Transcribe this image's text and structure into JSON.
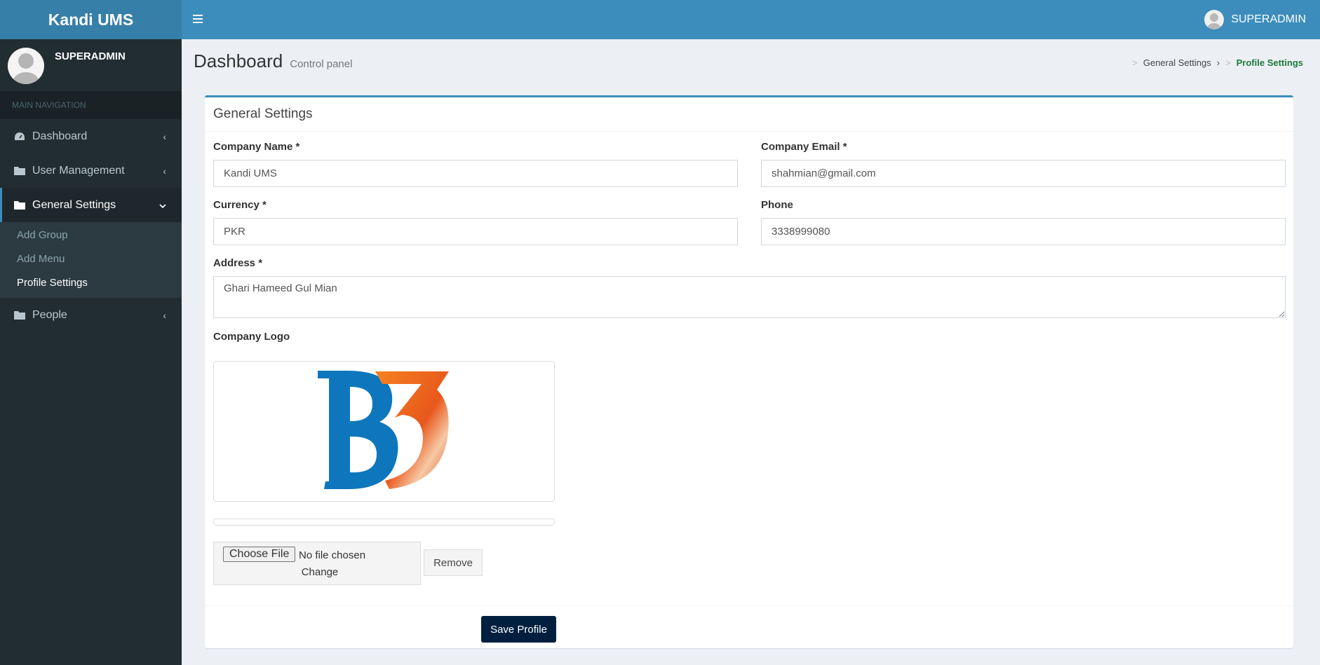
{
  "app": {
    "title": "Kandi UMS"
  },
  "topbar": {
    "user_name": "SUPERADMIN"
  },
  "sidebar": {
    "user_name": "SUPERADMIN",
    "section_header": "MAIN NAVIGATION",
    "items": [
      {
        "label": "Dashboard",
        "icon": "dashboard-icon"
      },
      {
        "label": "User Management",
        "icon": "folder-icon"
      },
      {
        "label": "General Settings",
        "icon": "folder-icon",
        "expanded": true,
        "children": [
          {
            "label": "Add Group"
          },
          {
            "label": "Add Menu"
          },
          {
            "label": "Profile Settings",
            "active": true
          }
        ]
      },
      {
        "label": "People",
        "icon": "folder-icon"
      }
    ]
  },
  "page": {
    "title": "Dashboard",
    "subtitle": "Control panel"
  },
  "breadcrumb": {
    "parent": "General Settings",
    "current": "Profile Settings"
  },
  "form": {
    "box_title": "General Settings",
    "company_name": {
      "label": "Company Name *",
      "value": "Kandi UMS"
    },
    "company_email": {
      "label": "Company Email *",
      "value": "shahmian@gmail.com"
    },
    "currency": {
      "label": "Currency *",
      "value": "PKR"
    },
    "phone": {
      "label": "Phone",
      "value": "3338999080"
    },
    "address": {
      "label": "Address *",
      "value": "Ghari Hameed Gul Mian"
    },
    "logo": {
      "label": "Company Logo",
      "logo_text": "B3"
    },
    "file": {
      "choose_label": "Choose File",
      "status": "No file chosen",
      "change_label": "Change",
      "remove_label": "Remove"
    },
    "save_label": "Save Profile"
  },
  "colors": {
    "header": "#3c8dbc",
    "logo_bg": "#367fa9",
    "sidebar": "#222d32",
    "save_button": "#001f3f",
    "breadcrumb_active": "#1d7a3b"
  }
}
